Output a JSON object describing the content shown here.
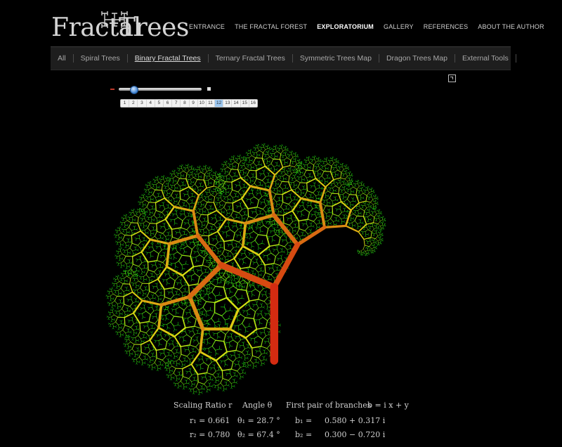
{
  "logo": {
    "word1": "Fractal",
    "word2": "Trees"
  },
  "topnav": [
    "ENTRANCE",
    "THE FRACTAL FOREST",
    "EXPLORATORIUM",
    "GALLERY",
    "REFERENCES",
    "ABOUT THE AUTHOR"
  ],
  "topnav_active": "EXPLORATORIUM",
  "subnav": [
    "All",
    "Spiral Trees",
    "Binary Fractal Trees",
    "Ternary Fractal Trees",
    "Symmetric Trees Map",
    "Dragon Trees Map",
    "External Tools"
  ],
  "subnav_active": "Binary Fractal Trees",
  "slider": {
    "selected": 12,
    "steps": [
      "1",
      "2",
      "3",
      "4",
      "5",
      "6",
      "7",
      "8",
      "9",
      "10",
      "11",
      "12",
      "13",
      "14",
      "15",
      "16"
    ]
  },
  "formula": {
    "headers": {
      "ratio": "Scaling Ratio r",
      "angle": "Angle θ",
      "branches": "First pair of branches",
      "eq": "b = i x + y"
    },
    "r1": "r₁ = 0.661",
    "theta1": "θ₁ = 28.7 °",
    "b1_label": "b₁ =",
    "b1_val": "0.580 + 0.317 i",
    "r2": "r₂ = 0.780",
    "theta2": "θ₂ = 67.4 °",
    "b2_label": "b₂ =",
    "b2_val": "0.300 − 0.720 i"
  },
  "colors": {
    "trunk": "#d2401c",
    "branch_mid": "#d9c830",
    "leaf": "#3fcf2a"
  }
}
